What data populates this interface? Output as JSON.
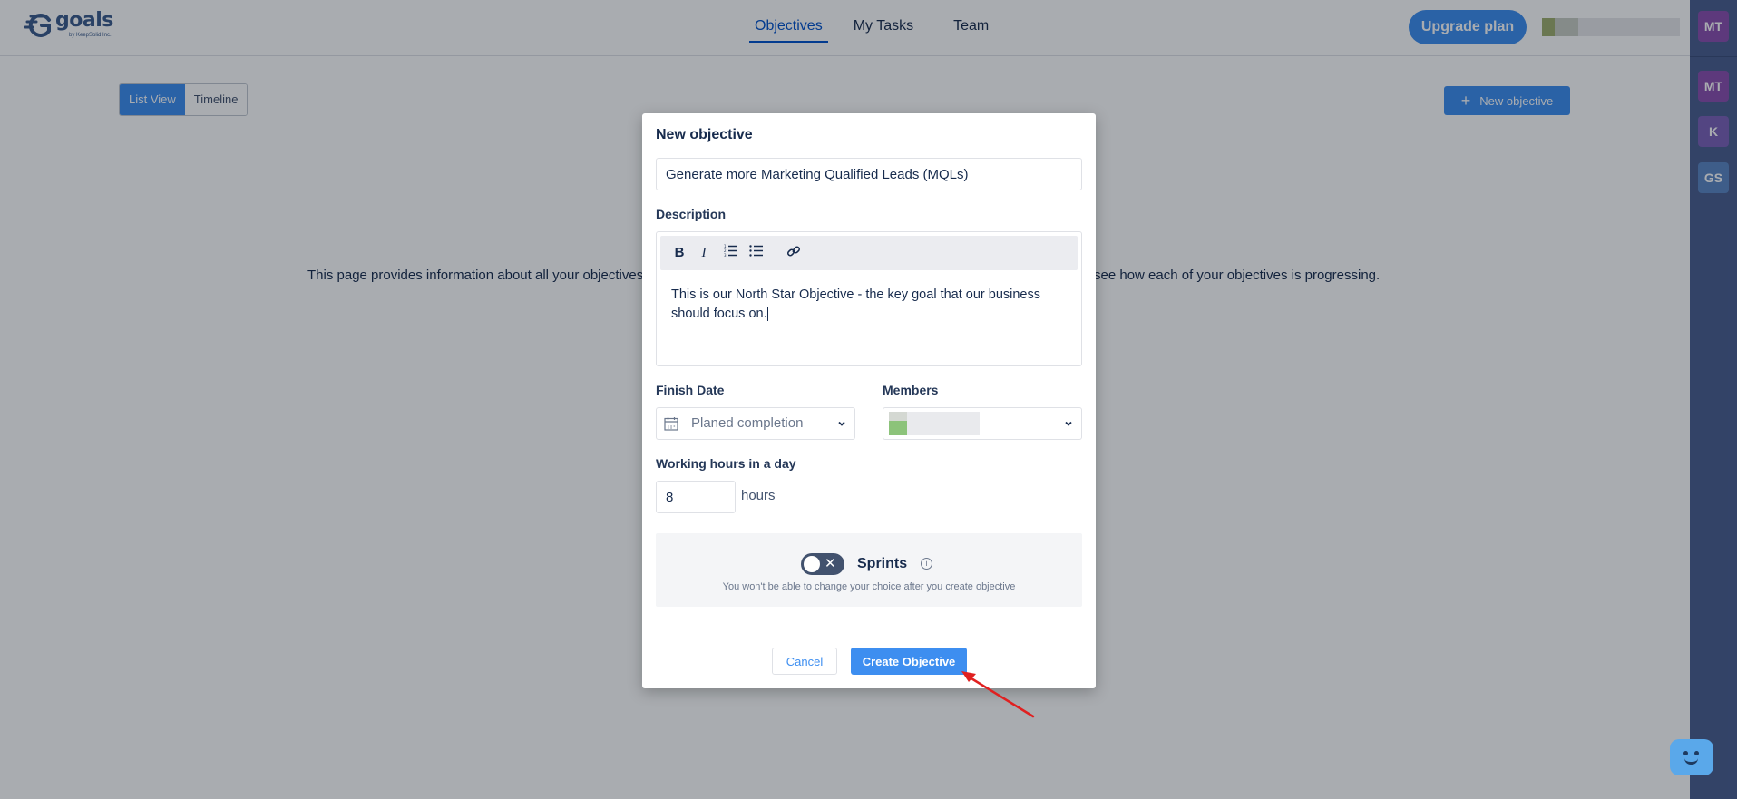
{
  "app": {
    "logo_text": "goals",
    "logo_subtext": "by KeepSolid Inc.",
    "nav": [
      "Objectives",
      "My Tasks",
      "Team"
    ],
    "upgrade_label": "Upgrade plan"
  },
  "page": {
    "view_toggle": [
      "List View",
      "Timeline"
    ],
    "new_objective_label": "New objective",
    "info_left": "This page provides information about all your objectives",
    "info_right": "see how each of your objectives is progressing."
  },
  "rail": {
    "avatars": [
      {
        "initials": "MT",
        "color": "#8b4fb0"
      },
      {
        "initials": "MT",
        "color": "#8b4fb0"
      },
      {
        "initials": "K",
        "color": "#7b61b8"
      },
      {
        "initials": "GS",
        "color": "#5b86c4"
      }
    ]
  },
  "modal": {
    "title": "New objective",
    "objective_name": "Generate more Marketing Qualified Leads (MQLs)",
    "description_label": "Description",
    "toolbar": {
      "bold": "B",
      "italic": "I",
      "ordered_list": "ordered-list-icon",
      "bullet_list": "bullet-list-icon",
      "link": "link-icon"
    },
    "description_text": "This is our North Star Objective - the key goal that our business should focus on.",
    "finish_date_label": "Finish Date",
    "finish_date_placeholder": "Planed completion",
    "members_label": "Members",
    "working_hours_label": "Working hours in a day",
    "working_hours_value": "8",
    "hours_unit": "hours",
    "sprints_label": "Sprints",
    "sprints_enabled": false,
    "sprints_note": "You won't be able to change your choice after you create objective",
    "cancel_label": "Cancel",
    "create_label": "Create Objective"
  },
  "colors": {
    "primary": "#3d8ef0",
    "rail": "#4a5f8f",
    "annotation_arrow": "#e02020"
  }
}
